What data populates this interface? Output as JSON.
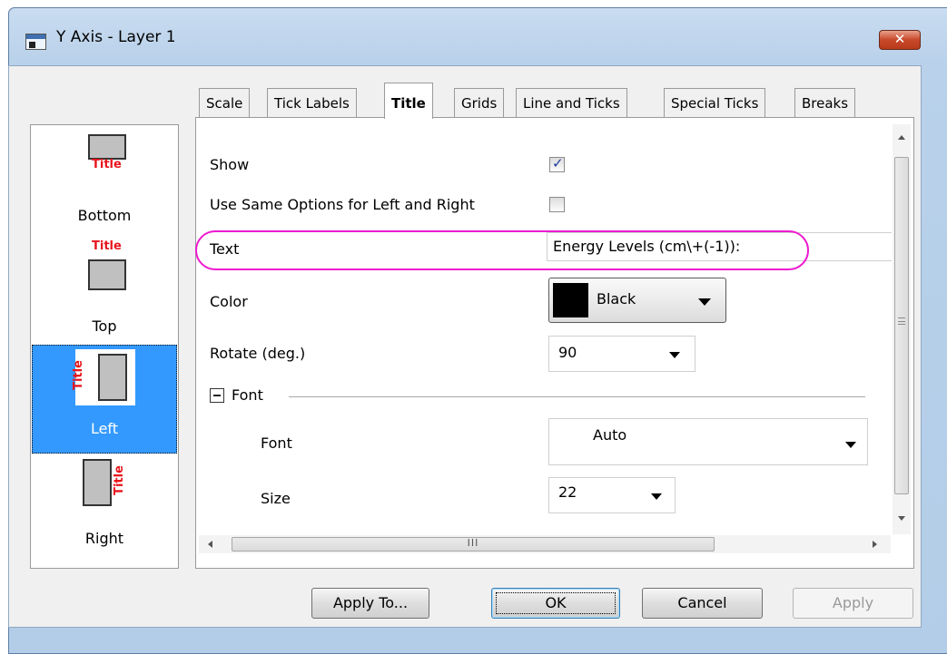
{
  "window": {
    "title": "Y Axis - Layer 1",
    "close_glyph": "✕"
  },
  "axis_list": [
    {
      "label": "Bottom",
      "icon_text": "Title"
    },
    {
      "label": "Top",
      "icon_text": "Title"
    },
    {
      "label": "Left",
      "icon_text": "Title"
    },
    {
      "label": "Right",
      "icon_text": "Title"
    }
  ],
  "selected_axis": "Left",
  "tabs": [
    "Scale",
    "Tick Labels",
    "Title",
    "Grids",
    "Line and Ticks",
    "Special Ticks",
    "Breaks"
  ],
  "active_tab": "Title",
  "title_settings": {
    "show_label": "Show",
    "show_checked": true,
    "same_options_label": "Use Same Options for Left and Right",
    "same_options_checked": false,
    "text_label": "Text",
    "text_value": "Energy Levels (cm\\+(-1)):",
    "color_label": "Color",
    "color_value": "Black",
    "color_swatch": "#000000",
    "rotate_label": "Rotate (deg.)",
    "rotate_value": "90",
    "font_group_label": "Font",
    "font_label": "Font",
    "font_value": "Auto",
    "size_label": "Size",
    "size_value": "22"
  },
  "hscroll_grip": "III",
  "buttons": {
    "apply_to": "Apply To...",
    "ok": "OK",
    "cancel": "Cancel",
    "apply": "Apply"
  },
  "colors": {
    "highlight": "#ee1ad0",
    "selection": "#3399ff",
    "title_red": "#e8141c"
  }
}
